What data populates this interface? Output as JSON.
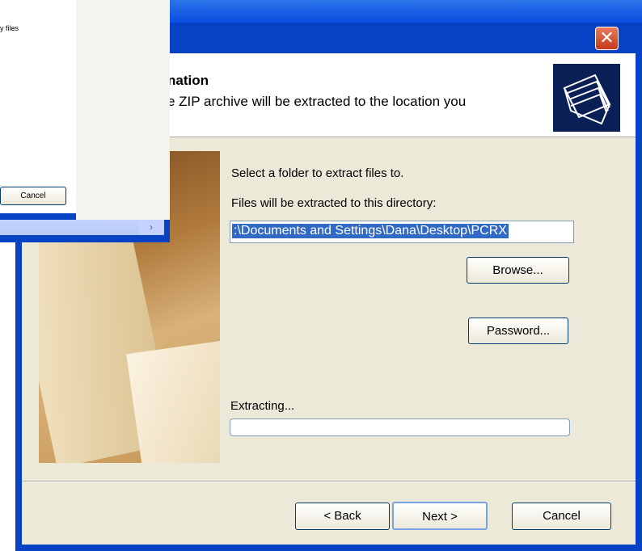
{
  "window": {
    "close_glyph": "✕"
  },
  "header": {
    "title": "nation",
    "subtitle": "e ZIP archive will be extracted to the location you"
  },
  "form": {
    "select_label": "Select a folder to extract files to.",
    "dir_label": "Files will be extracted to this directory:",
    "path_value": ":\\Documents and Settings\\Dana\\Desktop\\PCRX",
    "browse_label": "Browse...",
    "password_label": "Password...",
    "extracting_label": "Extracting...",
    "progress": 0
  },
  "footer": {
    "back_label": "< Back",
    "next_label": "Next >",
    "cancel_label": "Cancel"
  },
  "background_window": {
    "fragment_text": "y files",
    "cancel_label": "Cancel",
    "scroll_arrow": "›"
  },
  "colors": {
    "titlebar": "#0a4ee2",
    "client": "#ece9d8",
    "selection": "#316ac5"
  }
}
